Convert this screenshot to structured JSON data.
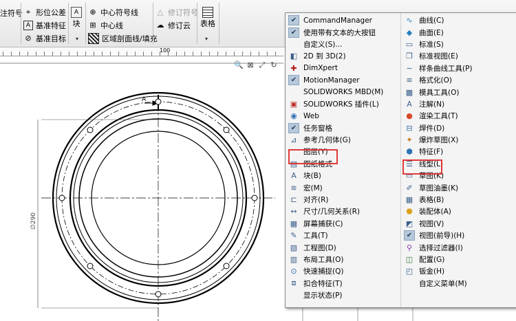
{
  "ribbon": {
    "col1": {
      "item1": "注符号"
    },
    "col2": {
      "item1": "形位公差",
      "item2": "基准特征",
      "item3": "基准目标"
    },
    "col3": {
      "item1": "块"
    },
    "col4": {
      "item1": "中心符号线",
      "item2": "中心线",
      "item3": "区域剖面线/填充"
    },
    "col5": {
      "item1": "修订符号",
      "item2": "修订云"
    },
    "col6": {
      "item1": "表格"
    }
  },
  "ruler": {
    "label": "100"
  },
  "drawing": {
    "section_label": "A",
    "dimension_label": "∅290",
    "accent_color": "#000000"
  },
  "menu": {
    "left": [
      {
        "label": "CommandManager",
        "icon": "check-icon",
        "checked": true
      },
      {
        "label": "使用带有文本的大按钮",
        "icon": "check-icon",
        "checked": true
      },
      {
        "label": "自定义(S)...",
        "icon": "",
        "checked": false
      },
      {
        "label": "2D 到 3D(2)",
        "icon": "2d-to-3d-icon",
        "checked": false
      },
      {
        "label": "DimXpert",
        "icon": "dimxpert-icon",
        "checked": false
      },
      {
        "label": "MotionManager",
        "icon": "check-icon",
        "checked": true
      },
      {
        "label": "SOLIDWORKS MBD(M)",
        "icon": "",
        "checked": false
      },
      {
        "label": "SOLIDWORKS 插件(L)",
        "icon": "addins-icon",
        "checked": false
      },
      {
        "label": "Web",
        "icon": "web-icon",
        "checked": false
      },
      {
        "label": "任务窗格",
        "icon": "check-icon",
        "checked": true
      },
      {
        "label": "参考几何体(G)",
        "icon": "reference-geometry-icon",
        "checked": false
      },
      {
        "label": "图层(Y)",
        "icon": "",
        "checked": false
      },
      {
        "label": "图纸格式",
        "icon": "sheet-format-icon",
        "checked": false
      },
      {
        "label": "块(B)",
        "icon": "block-icon",
        "checked": false
      },
      {
        "label": "宏(M)",
        "icon": "macro-icon",
        "checked": false
      },
      {
        "label": "对齐(R)",
        "icon": "align-icon",
        "checked": false
      },
      {
        "label": "尺寸/几何关系(R)",
        "icon": "dimension-icon",
        "checked": false
      },
      {
        "label": "屏幕捕获(C)",
        "icon": "screen-capture-icon",
        "checked": false
      },
      {
        "label": "工具(T)",
        "icon": "tools-icon",
        "checked": false
      },
      {
        "label": "工程图(D)",
        "icon": "drawing-icon",
        "checked": false
      },
      {
        "label": "布局工具(O)",
        "icon": "layout-tools-icon",
        "checked": false
      },
      {
        "label": "快速捕捉(Q)",
        "icon": "quick-snap-icon",
        "checked": false
      },
      {
        "label": "扣合特征(T)",
        "icon": "fastening-icon",
        "checked": false
      },
      {
        "label": "显示状态(P)",
        "icon": "",
        "checked": false
      }
    ],
    "right": [
      {
        "label": "曲线(C)",
        "icon": "curve-icon",
        "checked": false
      },
      {
        "label": "曲面(E)",
        "icon": "surface-icon",
        "checked": false
      },
      {
        "label": "标准(S)",
        "icon": "standard-icon",
        "checked": false
      },
      {
        "label": "标准视图(E)",
        "icon": "standard-views-icon",
        "checked": false
      },
      {
        "label": "样条曲线工具(P)",
        "icon": "spline-tools-icon",
        "checked": false
      },
      {
        "label": "格式化(O)",
        "icon": "format-icon",
        "checked": false
      },
      {
        "label": "模具工具(O)",
        "icon": "mold-tools-icon",
        "checked": false
      },
      {
        "label": "注解(N)",
        "icon": "annotation-icon",
        "checked": false
      },
      {
        "label": "渲染工具(T)",
        "icon": "render-tools-icon",
        "checked": false
      },
      {
        "label": "焊件(D)",
        "icon": "weldments-icon",
        "checked": false
      },
      {
        "label": "爆炸草图(X)",
        "icon": "explode-sketch-icon",
        "checked": false
      },
      {
        "label": "特征(F)",
        "icon": "features-icon",
        "checked": false
      },
      {
        "label": "线型(L)",
        "icon": "line-format-icon",
        "checked": false
      },
      {
        "label": "草图(K)",
        "icon": "sketch-icon",
        "checked": false
      },
      {
        "label": "草图油墨(K)",
        "icon": "sketch-ink-icon",
        "checked": false
      },
      {
        "label": "表格(B)",
        "icon": "table-icon",
        "checked": false
      },
      {
        "label": "装配体(A)",
        "icon": "assembly-icon",
        "checked": false
      },
      {
        "label": "视图(V)",
        "icon": "view-icon",
        "checked": false
      },
      {
        "label": "视图(前导)(H)",
        "icon": "check-icon",
        "checked": true
      },
      {
        "label": "选择过滤器(I)",
        "icon": "selection-filter-icon",
        "checked": false
      },
      {
        "label": "配置(G)",
        "icon": "configurations-icon",
        "checked": false
      },
      {
        "label": "钣金(H)",
        "icon": "sheet-metal-icon",
        "checked": false
      },
      {
        "label": "自定义菜单(M)",
        "icon": "",
        "checked": false
      }
    ],
    "highlight_color": "#e03a3a"
  }
}
